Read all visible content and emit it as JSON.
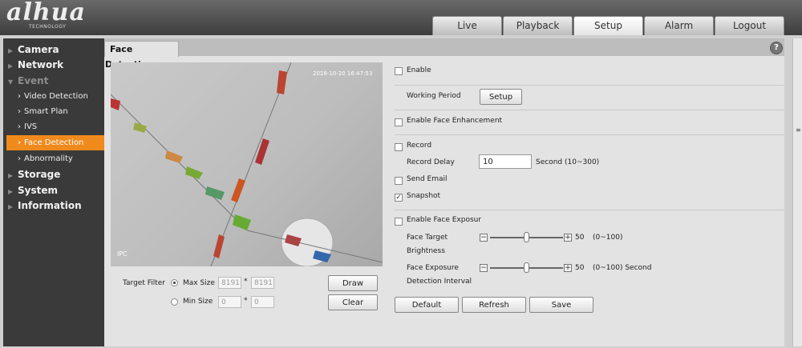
{
  "logo": {
    "text": "alhua",
    "subtext": "TECHNOLOGY"
  },
  "tabs": [
    "Live",
    "Playback",
    "Setup",
    "Alarm",
    "Logout"
  ],
  "sidebar": {
    "groups": [
      "Camera",
      "Network",
      "Event",
      "Storage",
      "System",
      "Information"
    ],
    "event_items": [
      "Video Detection",
      "Smart Plan",
      "IVS",
      "Face Detection",
      "Abnormality"
    ]
  },
  "page_title": "Face Detection",
  "help_label": "?",
  "video": {
    "timestamp": "2018-10-20 16:47:53",
    "ipc_label": "IPC"
  },
  "target_filter": {
    "label": "Target Filter",
    "max_size_label": "Max Size",
    "max_w": "8191",
    "max_h": "8191",
    "min_size_label": "Min Size",
    "min_w": "0",
    "min_h": "0",
    "times": "*",
    "selected": "Max Size"
  },
  "buttons": {
    "draw_target": "Draw Target",
    "clear": "Clear",
    "setup": "Setup",
    "default": "Default",
    "refresh": "Refresh",
    "save": "Save"
  },
  "settings": {
    "enable": {
      "label": "Enable",
      "checked": false
    },
    "working_period": "Working Period",
    "face_enhancement": {
      "label": "Enable Face Enhancement",
      "checked": false
    },
    "record": {
      "label": "Record",
      "checked": false
    },
    "record_delay": {
      "label": "Record Delay",
      "value": "10",
      "unit": "Second (10~300)"
    },
    "send_email": {
      "label": "Send Email",
      "checked": false
    },
    "snapshot": {
      "label": "Snapshot",
      "checked": true
    },
    "face_exposure": {
      "label": "Enable Face Exposur",
      "checked": false
    },
    "target_brightness": {
      "label_line1": "Face Target",
      "label_line2": "Brightness",
      "value": "50",
      "range": "(0~100)",
      "minus": "−",
      "plus": "+"
    },
    "exposure_interval": {
      "label_line1": "Face Exposure",
      "label_line2": "Detection Interval",
      "value": "50",
      "range": "(0~100) Second",
      "minus": "−",
      "plus": "+"
    }
  },
  "check_mark": "✓"
}
